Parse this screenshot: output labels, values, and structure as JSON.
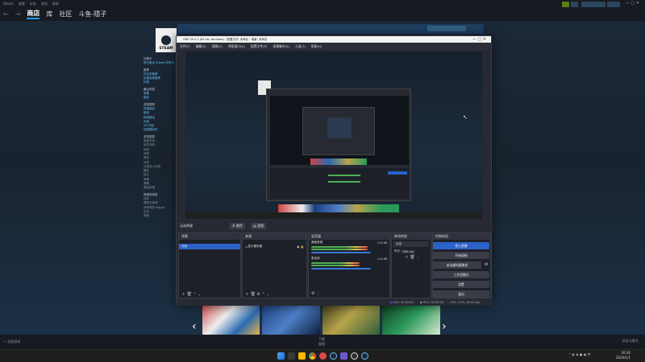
{
  "steam": {
    "titlebar_items": [
      "Steam",
      "查看",
      "好友",
      "游戏",
      "帮助"
    ],
    "nav": {
      "store": "商店",
      "library": "库",
      "community": "社区",
      "user": "斗鱼-隱子"
    },
    "logo_text": "STEAM",
    "sidebar": {
      "sections": [
        {
          "header": "礼物卡",
          "links": [
            "现已推出 Steam 礼物卡"
          ]
        },
        {
          "header": "推荐",
          "links": [
            "好友的推荐",
            "由鉴赏家推荐",
            "标签"
          ]
        },
        {
          "header": "最近浏览",
          "links": [
            "查看",
            "新品"
          ]
        },
        {
          "header": "浏览类别",
          "links": [
            "热销商品",
            "新品",
            "即将推出",
            "优惠",
            "VR 作品",
            "控制器友好"
          ]
        },
        {
          "header": "浏览类型",
          "links": [
            "免费开玩",
            "抢先体验",
            "休闲",
            "体育",
            "冒险",
            "动作",
            "大型多人在线",
            "模拟",
            "独立",
            "竞速",
            "策略",
            "角色扮演"
          ]
        },
        {
          "header": "按类别浏览",
          "links": [
            "动作",
            "冒险与休闲",
            "动作角色 Rogue",
            "生存",
            "其他"
          ]
        }
      ]
    },
    "bottom_left": "添加游戏",
    "bottom_center": "下载",
    "bottom_center_sub": "管理",
    "bottom_right": "好友与聊天"
  },
  "obs": {
    "title": "OBS 30.0.2 (64 bit, windows) - 配置文件: 未命名 - 场景: 未命名",
    "menu": [
      "文件(F)",
      "编辑(E)",
      "视图(V)",
      "停靠窗口(D)",
      "配置文件(P)",
      "场景集合(S)",
      "工具(T)",
      "帮助(H)"
    ],
    "dock_bar": {
      "left": "无选择源",
      "props": "属性",
      "filters": "滤镜"
    },
    "docks": {
      "scenes": {
        "title": "场景",
        "items": [
          "场景"
        ]
      },
      "sources": {
        "title": "来源",
        "items": [
          "显示器采集"
        ]
      },
      "mixer": {
        "title": "混音器",
        "channels": [
          {
            "name": "桌面音频",
            "db": "0.0 dB"
          },
          {
            "name": "麦克风",
            "db": "0.0 dB"
          }
        ]
      },
      "transitions": {
        "title": "转场特效",
        "type": "淡出",
        "duration_label": "时长",
        "duration": "300 ms"
      },
      "controls": {
        "title": "控制按钮",
        "buttons": [
          "停止直播",
          "开始录制",
          "启动虚拟摄像机",
          "工作室模式",
          "设置",
          "退出"
        ]
      }
    },
    "status": {
      "live": "LIVE: 00:00:00",
      "rec": "REC: 00:00:00",
      "cpu": "CPU: 0.3%, 60.00 fps"
    }
  },
  "taskbar": {
    "time": "16:34",
    "date": "2024/1/1"
  }
}
